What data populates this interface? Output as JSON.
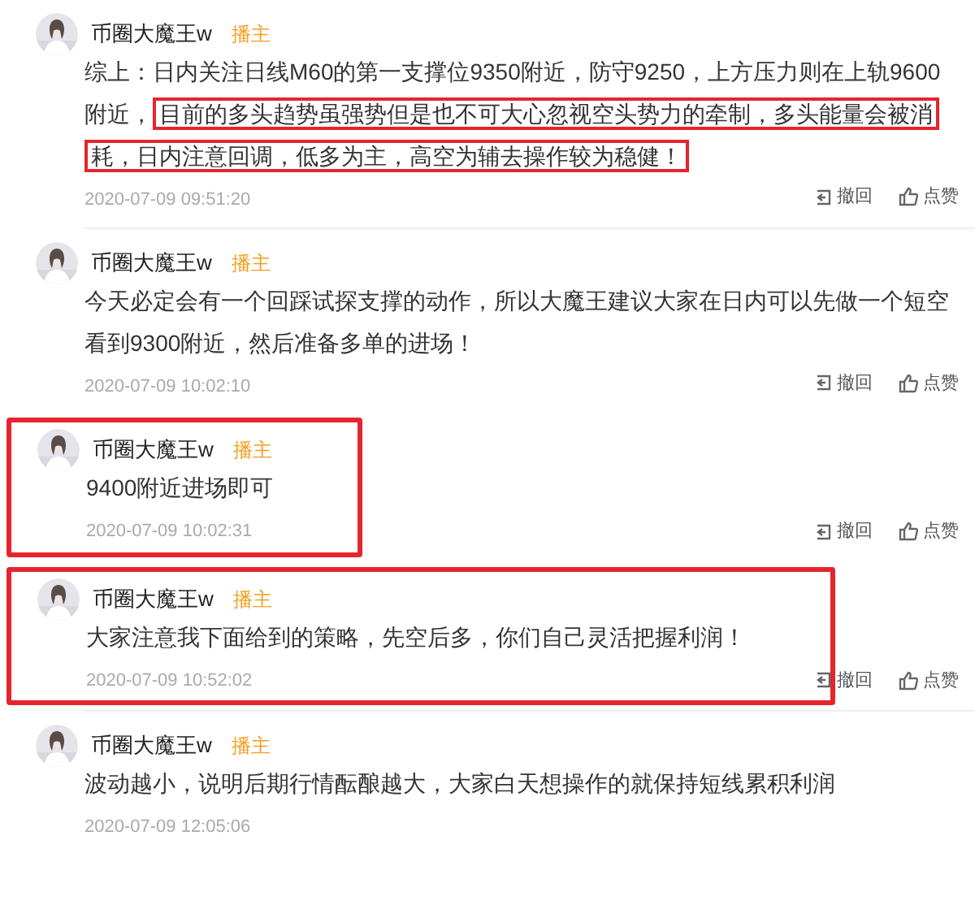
{
  "comments": [
    {
      "author": "币圈大魔王w",
      "badge": "播主",
      "highlighted": false,
      "segments": [
        {
          "text": "综上：日内关注日线M60的第一支撑位9350附近，防守9250，上方压力则在上轨9600附近，",
          "highlighted": false
        },
        {
          "text": "目前的多头趋势虽强势但是也不可大心忽视空头势力的牵制，多头能量会被消耗，日内注意回调，低多为主，高空为辅去操作较为稳健！",
          "highlighted": true
        }
      ],
      "time": "2020-07-09 09:51:20",
      "actions": [
        "撤回",
        "点赞"
      ]
    },
    {
      "author": "币圈大魔王w",
      "badge": "播主",
      "highlighted": false,
      "segments": [
        {
          "text": "今天必定会有一个回踩试探支撑的动作，所以大魔王建议大家在日内可以先做一个短空看到9300附近，然后准备多单的进场！",
          "highlighted": false
        }
      ],
      "time": "2020-07-09 10:02:10",
      "actions": [
        "撤回",
        "点赞"
      ]
    },
    {
      "author": "币圈大魔王w",
      "badge": "播主",
      "highlighted": true,
      "segments": [
        {
          "text": "9400附近进场即可",
          "highlighted": false
        }
      ],
      "time": "2020-07-09 10:02:31",
      "actions": [
        "撤回",
        "点赞"
      ]
    },
    {
      "author": "币圈大魔王w",
      "badge": "播主",
      "highlighted": true,
      "segments": [
        {
          "text": "大家注意我下面给到的策略，先空后多，你们自己灵活把握利润！",
          "highlighted": false
        }
      ],
      "time": "2020-07-09 10:52:02",
      "actions": [
        "撤回",
        "点赞"
      ]
    },
    {
      "author": "币圈大魔王w",
      "badge": "播主",
      "highlighted": false,
      "segments": [
        {
          "text": "波动越小，说明后期行情酝酿越大，大家白天想操作的就保持短线累积利润",
          "highlighted": false
        }
      ],
      "time": "2020-07-09 12:05:06"
    }
  ]
}
